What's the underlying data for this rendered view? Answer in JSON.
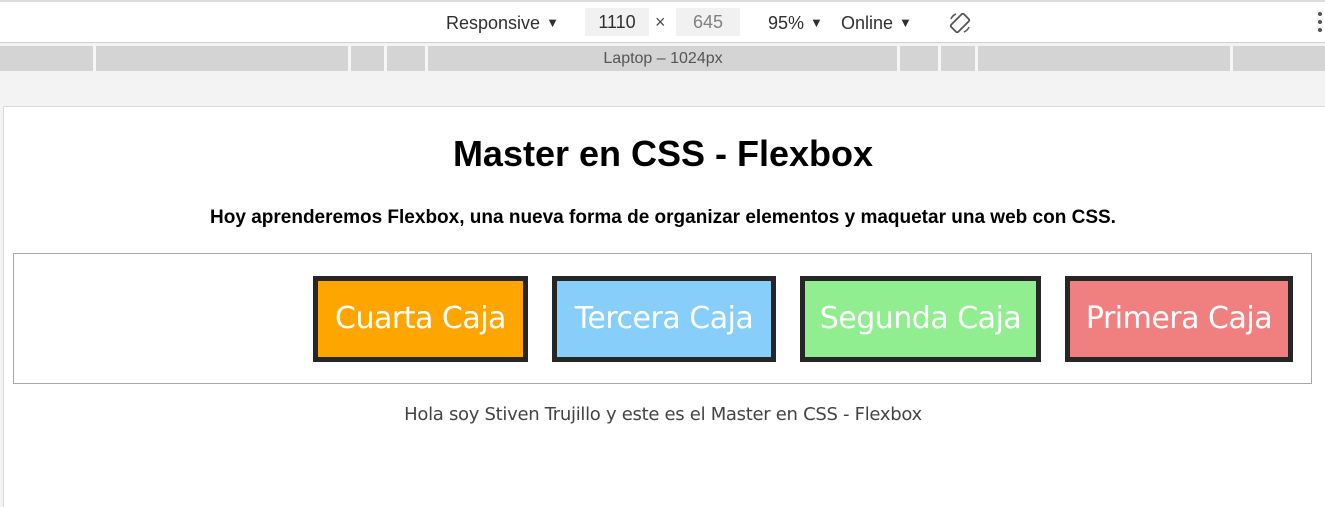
{
  "toolbar": {
    "device_label": "Responsive",
    "width_value": "1110",
    "times_symbol": "×",
    "height_value": "645",
    "zoom_label": "95%",
    "network_label": "Online",
    "caret": "▼"
  },
  "media_bar": {
    "label": "Laptop – 1024px"
  },
  "page": {
    "title": "Master en CSS - Flexbox",
    "subtitle": "Hoy aprenderemos Flexbox, una nueva forma de organizar elementos y maquetar una web con CSS.",
    "boxes": [
      {
        "label": "Primera Caja",
        "color": "#f08080"
      },
      {
        "label": "Segunda Caja",
        "color": "#90ee90"
      },
      {
        "label": "Tercera Caja",
        "color": "#87cefa"
      },
      {
        "label": "Cuarta Caja",
        "color": "#ffa500"
      }
    ],
    "footer": "Hola soy Stiven Trujillo y este es el Master en CSS - Flexbox"
  }
}
